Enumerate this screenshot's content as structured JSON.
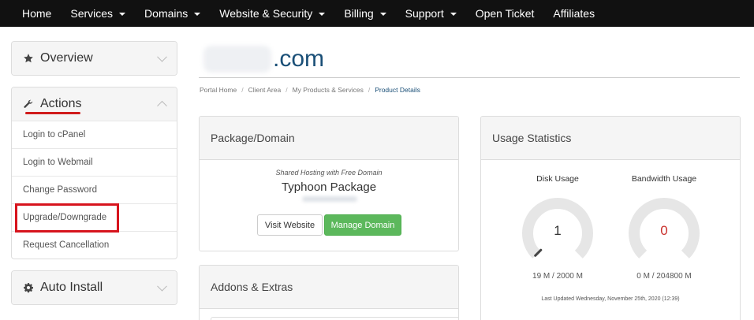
{
  "nav": {
    "items": [
      {
        "label": "Home",
        "dropdown": false
      },
      {
        "label": "Services",
        "dropdown": true
      },
      {
        "label": "Domains",
        "dropdown": true
      },
      {
        "label": "Website & Security",
        "dropdown": true
      },
      {
        "label": "Billing",
        "dropdown": true
      },
      {
        "label": "Support",
        "dropdown": true
      },
      {
        "label": "Open Ticket",
        "dropdown": false
      },
      {
        "label": "Affiliates",
        "dropdown": false
      }
    ]
  },
  "sidebar": {
    "overview": {
      "title": "Overview",
      "icon": "star-icon"
    },
    "actions": {
      "title": "Actions",
      "icon": "wrench-icon",
      "items": [
        "Login to cPanel",
        "Login to Webmail",
        "Change Password",
        "Upgrade/Downgrade",
        "Request Cancellation"
      ]
    },
    "auto_install": {
      "title": "Auto Install",
      "icon": "gear-icon"
    }
  },
  "page": {
    "title": ".com",
    "breadcrumb": [
      "Portal Home",
      "Client Area",
      "My Products & Services",
      "Product Details"
    ]
  },
  "package": {
    "heading": "Package/Domain",
    "subtitle": "Shared Hosting with Free Domain",
    "name": "Typhoon Package",
    "visit_label": "Visit Website",
    "manage_label": "Manage Domain"
  },
  "addons": {
    "heading": "Addons & Extras"
  },
  "usage": {
    "heading": "Usage Statistics",
    "disk": {
      "label": "Disk Usage",
      "value": "1",
      "summary": "19 M / 2000 M",
      "fraction": 0.0095,
      "color": "#333333"
    },
    "bandwidth": {
      "label": "Bandwidth Usage",
      "value": "0",
      "summary": "0 M / 204800 M",
      "fraction": 0,
      "color": "#c9302c"
    },
    "last_updated": "Last Updated Wednesday, November 25th, 2020 (12:39)"
  },
  "colors": {
    "accent": "#1a4f77",
    "highlight": "#d7141d",
    "manage_button": "#5cb85c"
  }
}
